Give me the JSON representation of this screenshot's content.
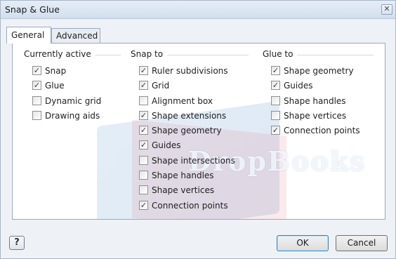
{
  "window": {
    "title": "Snap & Glue",
    "close_glyph": "✕"
  },
  "tabs": [
    {
      "label": "General",
      "active": true
    },
    {
      "label": "Advanced",
      "active": false
    }
  ],
  "groups": {
    "currently_active": {
      "label": "Currently active",
      "items": [
        {
          "label": "Snap",
          "checked": true
        },
        {
          "label": "Glue",
          "checked": true
        },
        {
          "label": "Dynamic grid",
          "checked": false
        },
        {
          "label": "Drawing aids",
          "checked": false
        }
      ]
    },
    "snap_to": {
      "label": "Snap to",
      "items": [
        {
          "label": "Ruler subdivisions",
          "checked": true
        },
        {
          "label": "Grid",
          "checked": true
        },
        {
          "label": "Alignment box",
          "checked": false
        },
        {
          "label": "Shape extensions",
          "checked": true
        },
        {
          "label": "Shape geometry",
          "checked": true
        },
        {
          "label": "Guides",
          "checked": true
        },
        {
          "label": "Shape intersections",
          "checked": false
        },
        {
          "label": "Shape handles",
          "checked": false
        },
        {
          "label": "Shape vertices",
          "checked": false
        },
        {
          "label": "Connection points",
          "checked": true
        }
      ]
    },
    "glue_to": {
      "label": "Glue to",
      "items": [
        {
          "label": "Shape geometry",
          "checked": true
        },
        {
          "label": "Guides",
          "checked": true
        },
        {
          "label": "Shape handles",
          "checked": false
        },
        {
          "label": "Shape vertices",
          "checked": false
        },
        {
          "label": "Connection points",
          "checked": true
        }
      ]
    }
  },
  "watermark": {
    "text": "DropBooks"
  },
  "footer": {
    "help_glyph": "?",
    "ok_label": "OK",
    "cancel_label": "Cancel"
  },
  "check_glyph": "✓"
}
